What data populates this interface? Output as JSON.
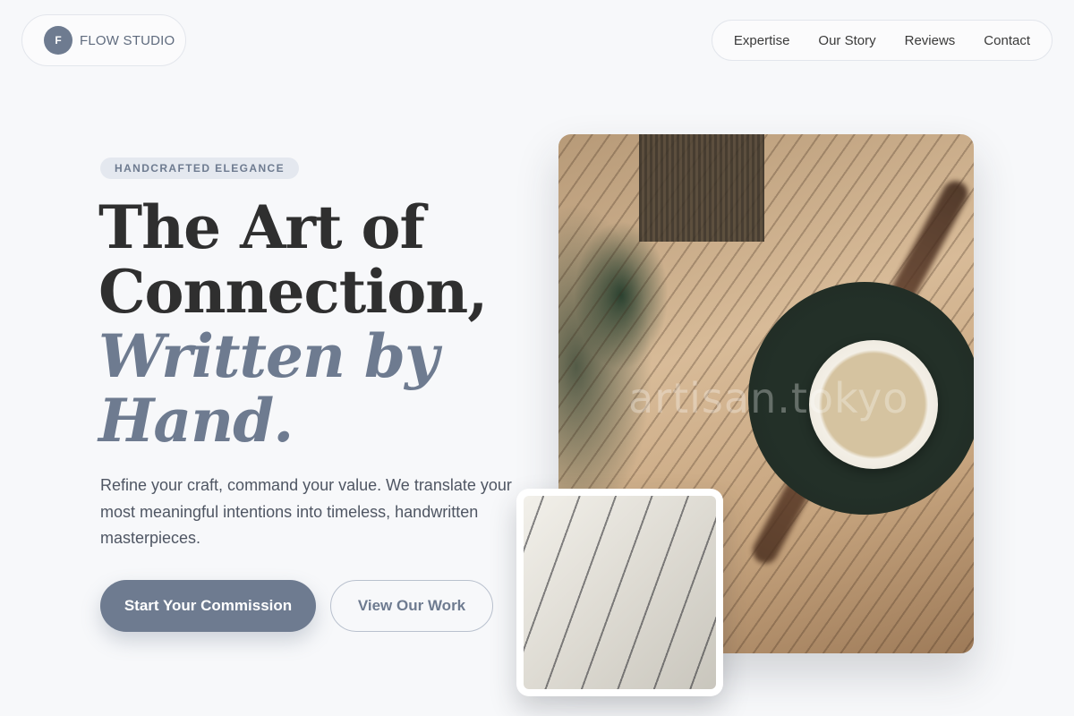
{
  "brand": {
    "badge": "F",
    "name": "FLOW STUDIO"
  },
  "nav": {
    "items": [
      "Expertise",
      "Our Story",
      "Reviews",
      "Contact"
    ]
  },
  "hero": {
    "tag": "HANDCRAFTED ELEGANCE",
    "headline_line1": "The Art of",
    "headline_line2": "Connection,",
    "headline_line3": "Written by",
    "headline_line4": "Hand.",
    "lede": "Refine your craft, command your value. We translate your most meaningful intentions into timeless, handwritten masterpieces.",
    "primary_cta": "Start Your Commission",
    "secondary_cta": "View Our Work"
  },
  "photo": {
    "watermark": "artisan.tokyo"
  },
  "colors": {
    "accent": "#6e7b90",
    "background": "#f7f8fa",
    "heading": "#2f2f2f"
  }
}
